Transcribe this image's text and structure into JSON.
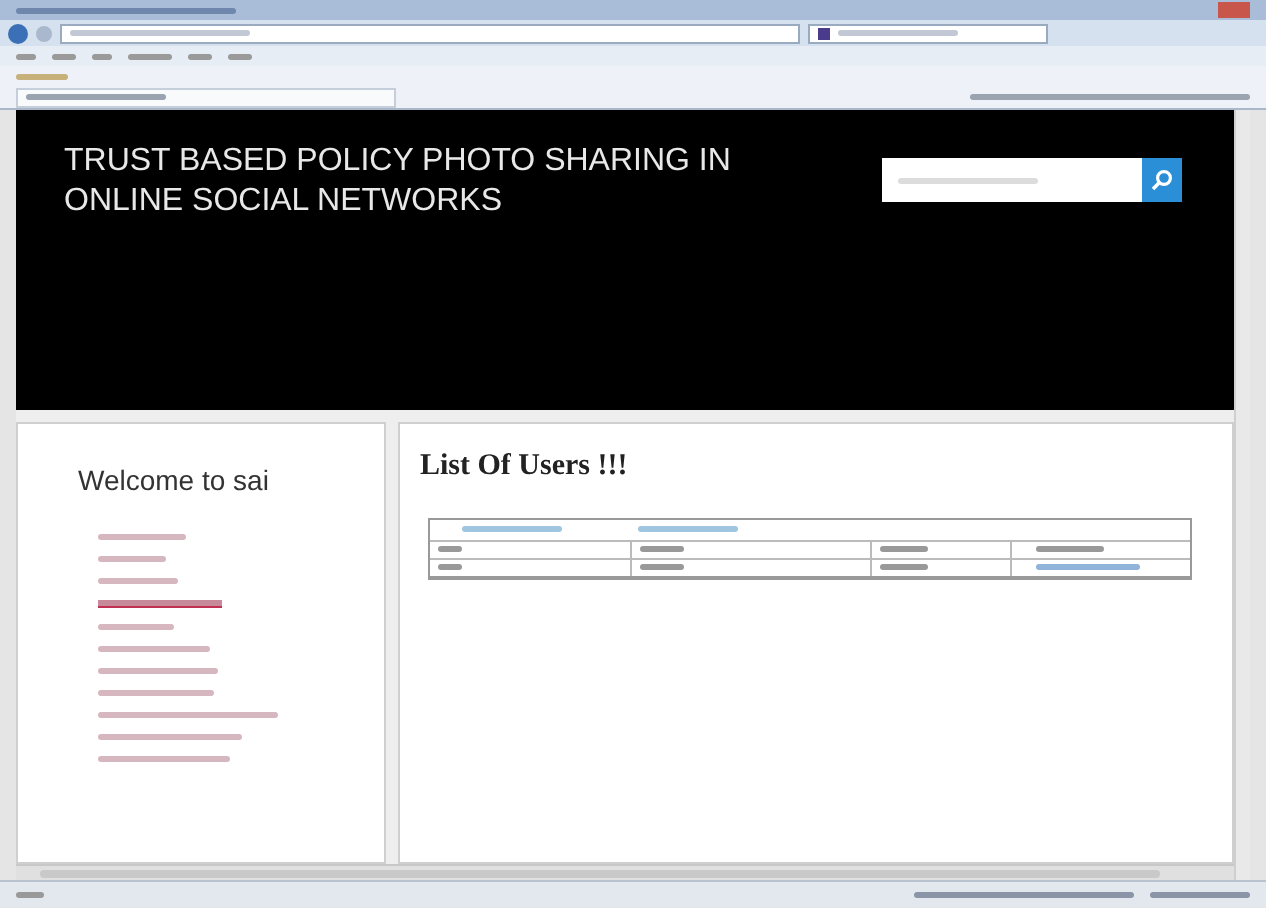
{
  "header": {
    "title": "TRUST BASED POLICY PHOTO SHARING IN ONLINE SOCIAL NETWORKS"
  },
  "sidebar": {
    "welcome": "Welcome to sai",
    "links": [
      {
        "selected": false
      },
      {
        "selected": false
      },
      {
        "selected": false
      },
      {
        "selected": true
      },
      {
        "selected": false
      },
      {
        "selected": false
      },
      {
        "selected": false
      },
      {
        "selected": false
      },
      {
        "selected": false
      },
      {
        "selected": false
      },
      {
        "selected": false
      }
    ]
  },
  "main": {
    "heading": "List Of Users !!!"
  }
}
